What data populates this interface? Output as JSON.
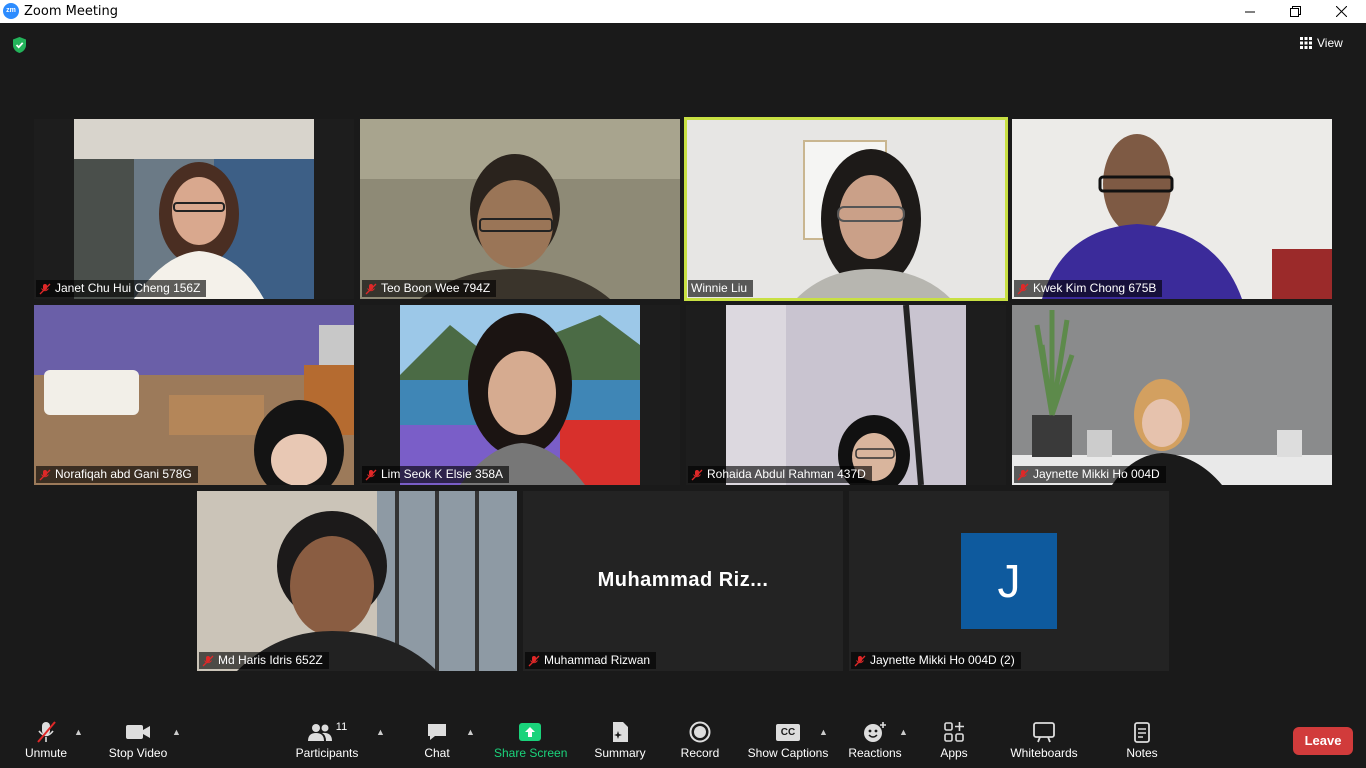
{
  "window": {
    "title": "Zoom Meeting",
    "app_icon": "zm"
  },
  "view_label": "View",
  "participants": [
    {
      "name": "Janet Chu Hui Cheng 156Z",
      "muted": true
    },
    {
      "name": "Teo Boon Wee 794Z",
      "muted": true
    },
    {
      "name": "Winnie Liu",
      "muted": false,
      "active_speaker": true
    },
    {
      "name": "Kwek Kim Chong 675B",
      "muted": true
    },
    {
      "name": "Norafiqah abd Gani 578G",
      "muted": true
    },
    {
      "name": "Lim Seok K Elsie 358A",
      "muted": true
    },
    {
      "name": "Rohaida Abdul Rahman 437D",
      "muted": true
    },
    {
      "name": "Jaynette Mikki Ho 004D",
      "muted": true
    },
    {
      "name": "Md Haris Idris 652Z",
      "muted": true
    },
    {
      "name": "Muhammad Rizwan",
      "muted": true,
      "display_name": "Muhammad  Riz..."
    },
    {
      "name": "Jaynette Mikki Ho 004D (2)",
      "muted": true,
      "avatar_letter": "J"
    }
  ],
  "toolbar": {
    "unmute": "Unmute",
    "stop_video": "Stop Video",
    "participants": "Participants",
    "participants_count": "11",
    "chat": "Chat",
    "share_screen": "Share Screen",
    "summary": "Summary",
    "record": "Record",
    "show_captions": "Show Captions",
    "cc": "CC",
    "reactions": "Reactions",
    "apps": "Apps",
    "whiteboards": "Whiteboards",
    "notes": "Notes",
    "leave": "Leave"
  },
  "colors": {
    "active_speaker": "#c8e043",
    "leave": "#d13b3b",
    "share": "#1ad37b",
    "avatar": "#0e5a9e"
  }
}
